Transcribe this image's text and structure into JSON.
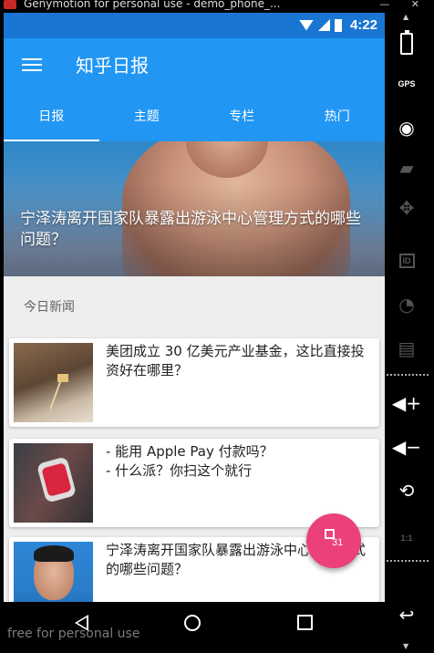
{
  "window": {
    "title": "Genymotion for personal use - demo_phone_...",
    "controls": "—  ✕"
  },
  "status_bar": {
    "time": "4:22"
  },
  "app_bar": {
    "title": "知乎日报"
  },
  "tabs": [
    {
      "label": "日报",
      "active": true
    },
    {
      "label": "主题",
      "active": false
    },
    {
      "label": "专栏",
      "active": false
    },
    {
      "label": "热门",
      "active": false
    }
  ],
  "hero": {
    "title": "宁泽涛离开国家队暴露出游泳中心管理方式的哪些问题？"
  },
  "section": {
    "label": "今日新闻"
  },
  "stories": [
    {
      "title": "美团成立 30 亿美元产业基金，这比直接投资好在哪里？",
      "thumb": "flag-on-rock-image"
    },
    {
      "title": "- 能用 Apple Pay 付款吗？\n- 什么派？你扫这个就行",
      "thumb": "apple-watch-image"
    },
    {
      "title": "宁泽涛离开国家队暴露出游泳中心管理方式的哪些问题？",
      "thumb": "swimmer-portrait-image"
    }
  ],
  "fab": {
    "label": "31",
    "icon": "calendar-icon",
    "color": "#ec407a"
  },
  "watermark": "free for personal use",
  "toolbar": {
    "gps_label": "GPS",
    "id_label": "ID",
    "rotate_text": "1:1"
  },
  "colors": {
    "primary": "#2196f3",
    "primary_dark": "#1976d2",
    "accent": "#ec407a"
  }
}
